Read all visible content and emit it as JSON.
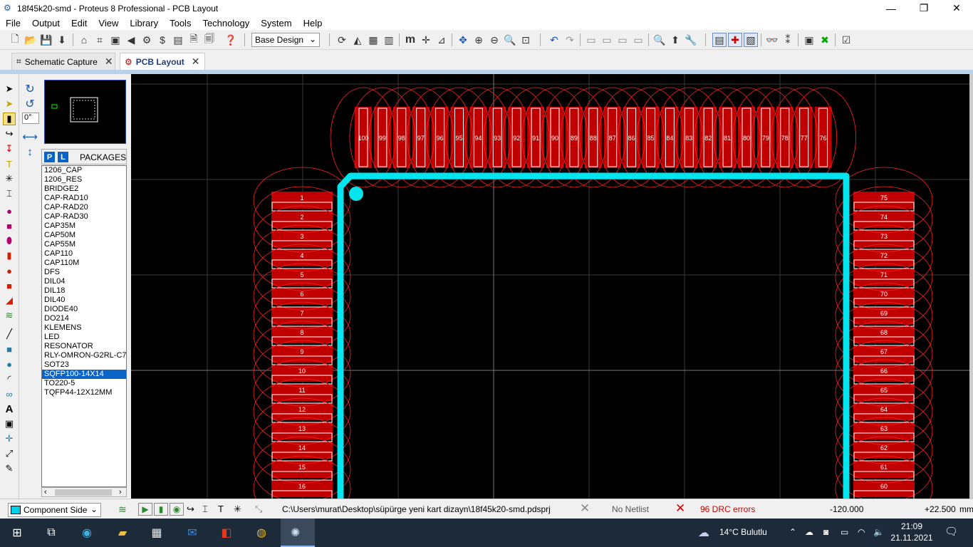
{
  "window": {
    "title": "18f45k20-smd - Proteus 8 Professional - PCB Layout",
    "minimize": "—",
    "maximize": "❐",
    "close": "✕"
  },
  "menu": [
    "File",
    "Output",
    "Edit",
    "View",
    "Library",
    "Tools",
    "Technology",
    "System",
    "Help"
  ],
  "toolbar": {
    "design_select": "Base Design"
  },
  "tabs": [
    {
      "label": "Schematic Capture",
      "close": "✕"
    },
    {
      "label": "PCB Layout",
      "close": "✕"
    }
  ],
  "rotation": {
    "value": "0°"
  },
  "packages": {
    "mode_p": "P",
    "mode_l": "L",
    "header": "PACKAGES",
    "items": [
      "1206_CAP",
      "1206_RES",
      "BRIDGE2",
      "CAP-RAD10",
      "CAP-RAD20",
      "CAP-RAD30",
      "CAP35M",
      "CAP50M",
      "CAP55M",
      "CAP110",
      "CAP110M",
      "DFS",
      "DIL04",
      "DIL18",
      "DIL40",
      "DIODE40",
      "DO214",
      "KLEMENS",
      "LED",
      "RESONATOR",
      "RLY-OMRON-G2RL-C7",
      "SOT23",
      "SQFP100-14X14",
      "TO220-5",
      "TQFP44-12X12MM"
    ],
    "selected": "SQFP100-14X14"
  },
  "pcb": {
    "pads_top": [
      "100",
      "99",
      "98",
      "97",
      "96",
      "95",
      "94",
      "93",
      "92",
      "91",
      "90",
      "89",
      "88",
      "87",
      "86",
      "85",
      "84",
      "83",
      "82",
      "81",
      "80",
      "79",
      "78",
      "77",
      "76"
    ],
    "pads_left": [
      "1",
      "2",
      "3",
      "4",
      "5",
      "6",
      "7",
      "8",
      "9",
      "10",
      "11",
      "12",
      "13",
      "14",
      "15",
      "16"
    ],
    "pads_right": [
      "75",
      "74",
      "73",
      "72",
      "71",
      "70",
      "69",
      "68",
      "67",
      "66",
      "65",
      "64",
      "63",
      "62",
      "61",
      "60"
    ],
    "colors": {
      "pad": "#c00000",
      "clearance": "#ff2020",
      "track": "#00e5ee",
      "grid": "#555555"
    }
  },
  "status": {
    "layer": "Component Side",
    "path": "C:\\Users\\murat\\Desktop\\süpürge yeni kart dizayn\\18f45k20-smd.pdsprj",
    "netlist": "No Netlist",
    "drc": "96 DRC errors",
    "coord_x": "-120.000",
    "coord_y": "+22.500",
    "unit": "mm"
  },
  "taskbar": {
    "weather": "14°C  Bulutlu",
    "time": "21:09",
    "date": "21.11.2021"
  }
}
